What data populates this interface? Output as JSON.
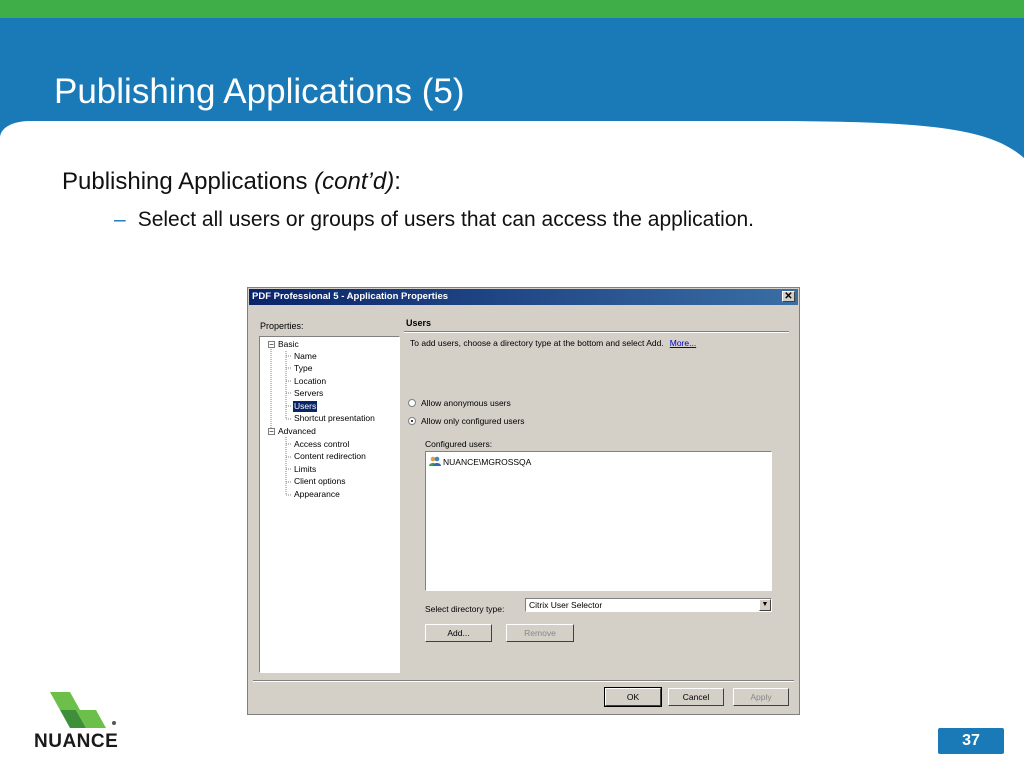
{
  "slide": {
    "title": "Publishing Applications (5)",
    "bullet_main": "Publishing Applications ",
    "bullet_main_italic": "(cont’d)",
    "bullet_main_suffix": ":",
    "dash": "–",
    "bullet_sub": "Select all users or groups of users that can access the application.",
    "page_number": "37",
    "logo_text": "NUANCE",
    "colors": {
      "header_blue": "#1a7ab8",
      "top_green": "#3fae49",
      "badge_blue": "#1a7ab8"
    }
  },
  "dialog": {
    "title": "PDF Professional 5 - Application Properties",
    "close_glyph": "✕",
    "properties_label": "Properties:",
    "tree": {
      "basic": "Basic",
      "basic_items": [
        "Name",
        "Type",
        "Location",
        "Servers",
        "Users",
        "Shortcut presentation"
      ],
      "advanced": "Advanced",
      "advanced_items": [
        "Access control",
        "Content redirection",
        "Limits",
        "Client options",
        "Appearance"
      ],
      "expander_glyph": "−",
      "selected": "Users"
    },
    "panel": {
      "title": "Users",
      "instruction": "To add users, choose a directory type at the bottom and select Add.",
      "more_link": "More...",
      "radio_anonymous": "Allow anonymous users",
      "radio_configured": "Allow only configured users",
      "radio_selected": "configured",
      "configured_label": "Configured users:",
      "configured_users": [
        "NUANCE\\MGROSSQA"
      ],
      "user_icon": "user-group-icon",
      "directory_label": "Select directory type:",
      "directory_value": "Citrix User Selector",
      "dropdown_glyph": "▼",
      "add_button": "Add...",
      "remove_button": "Remove"
    },
    "footer": {
      "ok": "OK",
      "cancel": "Cancel",
      "apply": "Apply"
    }
  }
}
